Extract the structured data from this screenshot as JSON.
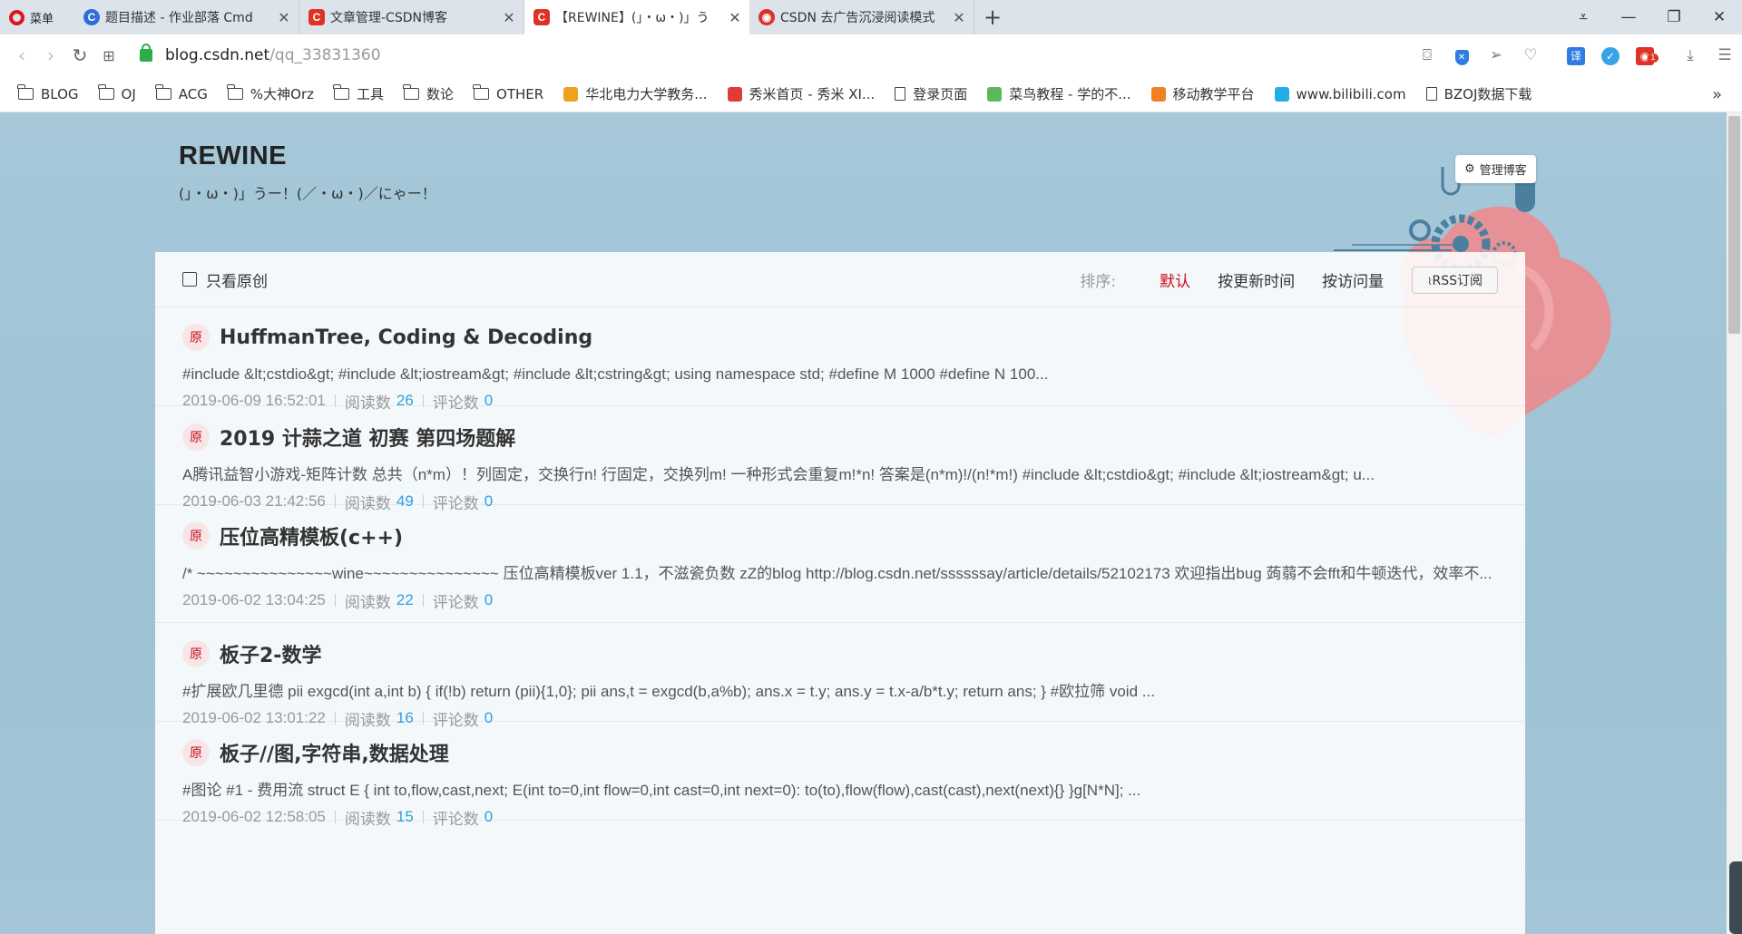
{
  "browser": {
    "menu_label": "菜单",
    "tabs": [
      {
        "title": "题目描述 - 作业部落 Cmd",
        "favicon": "c-blue",
        "glyph": "C",
        "active": false
      },
      {
        "title": "文章管理-CSDN博客",
        "favicon": "c-red",
        "glyph": "C",
        "active": false
      },
      {
        "title": "【REWINE】(」・ω・)」う",
        "favicon": "c-red",
        "glyph": "C",
        "active": true
      },
      {
        "title": "CSDN 去广告沉浸阅读模式",
        "favicon": "c-red2",
        "glyph": "◉",
        "active": false
      }
    ],
    "url_host": "blog.csdn.net",
    "url_path": "/qq_33831360",
    "notification_count": "1"
  },
  "bookmarks": [
    {
      "label": "BLOG",
      "type": "folder"
    },
    {
      "label": "OJ",
      "type": "folder"
    },
    {
      "label": "ACG",
      "type": "folder"
    },
    {
      "label": "%大神Orz",
      "type": "folder"
    },
    {
      "label": "工具",
      "type": "folder"
    },
    {
      "label": "数论",
      "type": "folder"
    },
    {
      "label": "OTHER",
      "type": "folder"
    },
    {
      "label": "华北电力大学教务...",
      "type": "site",
      "color": "#f0a020"
    },
    {
      "label": "秀米首页 - 秀米 XI...",
      "type": "site",
      "color": "#e03a3a"
    },
    {
      "label": "登录页面",
      "type": "page",
      "color": "#444444"
    },
    {
      "label": "菜鸟教程 - 学的不...",
      "type": "site",
      "color": "#5cb85c"
    },
    {
      "label": "移动教学平台",
      "type": "site",
      "color": "#f08020"
    },
    {
      "label": "www.bilibili.com",
      "type": "site",
      "color": "#23ade5"
    },
    {
      "label": "BZOJ数据下载",
      "type": "page",
      "color": "#444444"
    }
  ],
  "blog": {
    "title": "REWINE",
    "subtitle": "(」・ω・)」うー！(／・ω・)／にゃー！",
    "manage_label": "管理博客"
  },
  "filter": {
    "only_original": "只看原创",
    "sort_label": "排序:",
    "sort_default": "默认",
    "sort_updated": "按更新时间",
    "sort_views": "按访问量",
    "rss": "RSS订阅"
  },
  "articles": [
    {
      "badge": "原",
      "title": "HuffmanTree, Coding & Decoding",
      "excerpt": "#include &lt;cstdio&gt; #include &lt;iostream&gt; #include &lt;cstring&gt; using namespace std; #define M 1000 #define N 100...",
      "date": "2019-06-09 16:52:01",
      "views_label": "阅读数",
      "views": "26",
      "comments_label": "评论数",
      "comments": "0"
    },
    {
      "badge": "原",
      "title": "2019 计蒜之道 初赛 第四场题解",
      "excerpt": "A腾讯益智小游戏-矩阵计数 总共（n*m）！列固定，交换行n! 行固定，交换列m! 一种形式会重复m!*n! 答案是(n*m)!/(n!*m!) #include &lt;cstdio&gt; #include &lt;iostream&gt; u...",
      "date": "2019-06-03 21:42:56",
      "views_label": "阅读数",
      "views": "49",
      "comments_label": "评论数",
      "comments": "0"
    },
    {
      "badge": "原",
      "title": "压位高精模板(c++)",
      "excerpt": "/* ~~~~~~~~~~~~~~~wine~~~~~~~~~~~~~~~ 压位高精模板ver 1.1，不滋瓷负数 zZ的blog http://blog.csdn.net/ssssssay/article/details/52102173 欢迎指出bug 蒟蒻不会fft和牛顿迭代，效率不...",
      "date": "2019-06-02 13:04:25",
      "views_label": "阅读数",
      "views": "22",
      "comments_label": "评论数",
      "comments": "0"
    },
    {
      "badge": "原",
      "title": "板子2-数学",
      "excerpt": "#扩展欧几里德 pii exgcd(int a,int b) { if(!b) return (pii){1,0}; pii ans,t = exgcd(b,a%b); ans.x = t.y; ans.y = t.x-a/b*t.y; return ans; } #欧拉筛 void ...",
      "date": "2019-06-02 13:01:22",
      "views_label": "阅读数",
      "views": "16",
      "comments_label": "评论数",
      "comments": "0"
    },
    {
      "badge": "原",
      "title": "板子//图,字符串,数据处理",
      "excerpt": "#图论 #1 - 费用流 struct E { int to,flow,cast,next; E(int to=0,int flow=0,int cast=0,int next=0): to(to),flow(flow),cast(cast),next(next){} }g[N*N]; ...",
      "date": "2019-06-02 12:58:05",
      "views_label": "阅读数",
      "views": "15",
      "comments_label": "评论数",
      "comments": "0"
    }
  ]
}
